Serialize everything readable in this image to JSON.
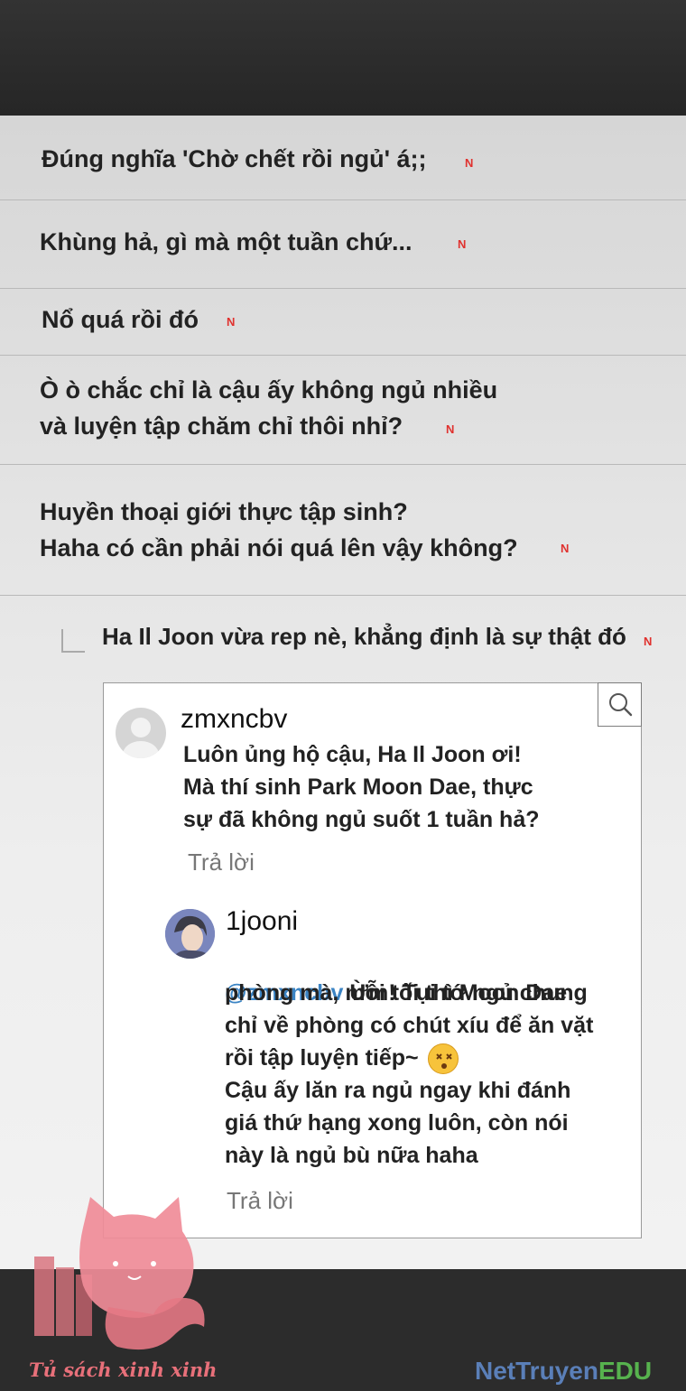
{
  "comments": [
    {
      "text": "Đúng nghĩa 'Chờ chết rồi ngủ' á;;",
      "badge": "N"
    },
    {
      "text": "Khùng hả, gì mà một tuần chứ...",
      "badge": "N"
    },
    {
      "text": "Nổ quá rồi đó",
      "badge": "N"
    },
    {
      "text": "Ò ò chắc chỉ là cậu ấy không ngủ nhiều\nvà luyện tập chăm chỉ thôi nhỉ?",
      "badge": "N"
    },
    {
      "text": "Huyền thoại giới thực tập sinh?\nHaha có cần phải nói quá lên vậy không?",
      "badge": "N"
    }
  ],
  "reply_comment": {
    "text": "Ha Il Joon vừa rep nè, khẳng định là sự thật đó",
    "badge": "N"
  },
  "post": {
    "username": "zmxncbv",
    "message": "Luôn ủng hộ cậu, Ha Il Joon ơi!\nMà thí sinh Park Moon Dae, thực\nsự đã không ngủ suốt 1 tuần hả?",
    "reply_label": "Trả lời",
    "reply": {
      "username": "1jooni",
      "mention": "@zmxncbv",
      "line1": " Ừm! Tụi tớ ngủ chung",
      "line2": "phòng mà, mỗi tối thì Moon Dae",
      "line3": "chỉ về phòng có chút xíu để ăn vặt",
      "line4": "rồi tập luyện tiếp~",
      "rest": "Cậu ấy lăn ra ngủ ngay khi đánh\ngiá thứ hạng xong luôn, còn nói\nnày là ngủ bù nữa haha",
      "reply_label": "Trả lời"
    }
  },
  "watermarks": {
    "left": "Tủ sách xinh xinh",
    "right_a": "NetTruyen",
    "right_b": "EDU"
  },
  "icons": [
    "search-icon",
    "default-avatar-icon",
    "dizzy-face-emoji",
    "cat-mascot-logo"
  ],
  "colors": {
    "badge": "#e0312e",
    "mention": "#3b84c4",
    "panel": "#e6e6e6"
  }
}
